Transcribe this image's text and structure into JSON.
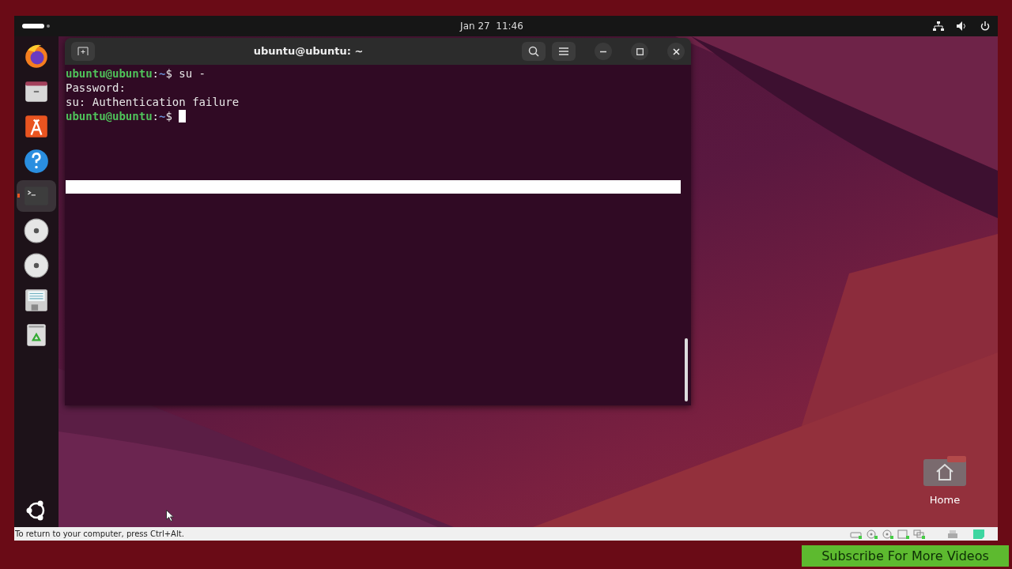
{
  "top_bar": {
    "date": "Jan 27",
    "time": "11:46"
  },
  "dock": {
    "items": [
      {
        "kind": "browser",
        "selected": false
      },
      {
        "kind": "folder",
        "selected": false
      },
      {
        "kind": "store",
        "selected": false
      },
      {
        "kind": "help",
        "selected": false
      },
      {
        "kind": "terminal",
        "selected": true
      },
      {
        "kind": "disc",
        "selected": false
      },
      {
        "kind": "disc",
        "selected": false
      },
      {
        "kind": "drive",
        "selected": false
      },
      {
        "kind": "trash",
        "selected": false
      }
    ]
  },
  "terminal": {
    "title": "ubuntu@ubuntu: ~",
    "lines": [
      {
        "kind": "prompt",
        "user": "ubuntu@ubuntu",
        "sep": ":",
        "path": "~",
        "sign": "$",
        "command": "su -"
      },
      {
        "kind": "output",
        "text": "Password:"
      },
      {
        "kind": "output",
        "text": "su: Authentication failure"
      },
      {
        "kind": "prompt",
        "user": "ubuntu@ubuntu",
        "sep": ":",
        "path": "~",
        "sign": "$",
        "cursor": true
      }
    ]
  },
  "desktop_icons": [
    {
      "label": "Home"
    }
  ],
  "vm_status": {
    "hint": "To return to your computer, press Ctrl+Alt."
  },
  "banner": {
    "text": "Subscribe For More Videos"
  }
}
